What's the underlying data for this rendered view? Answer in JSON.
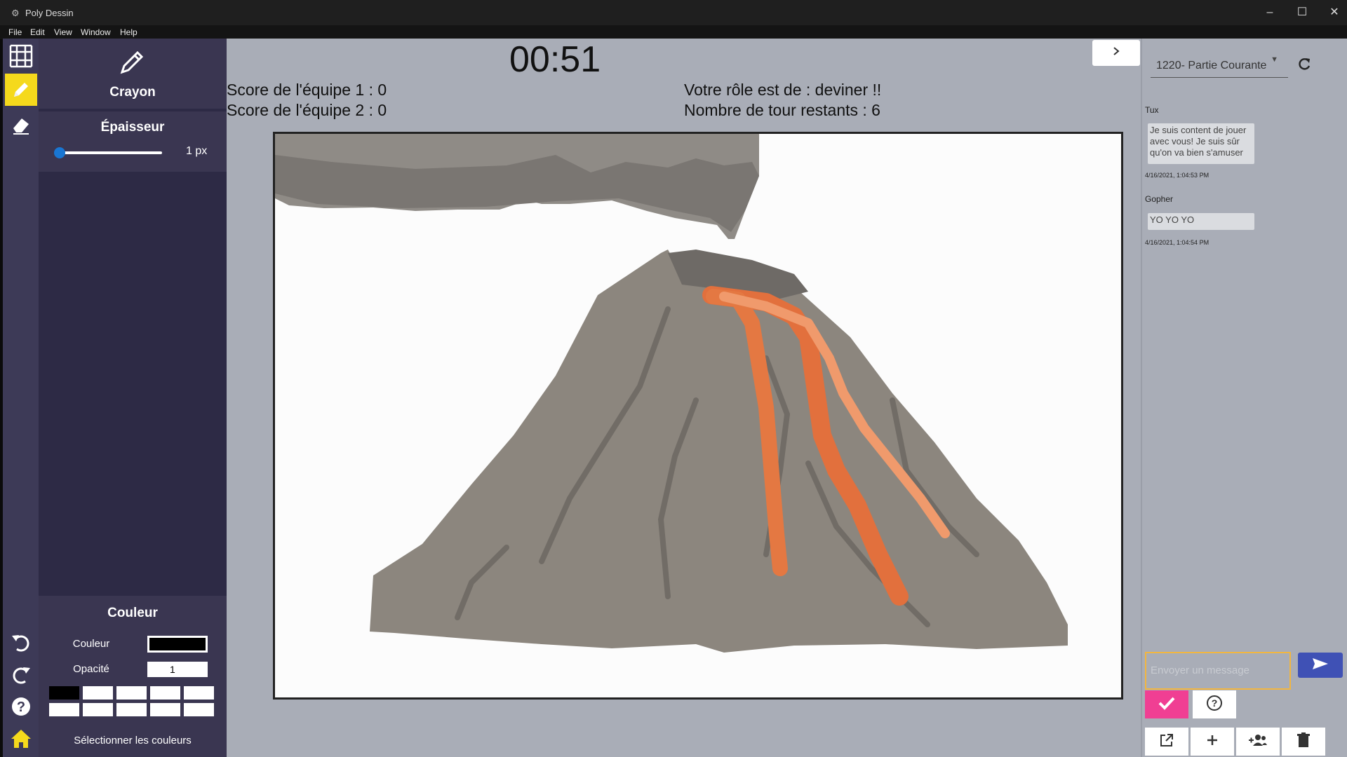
{
  "window": {
    "title": "Poly Dessin"
  },
  "menu": {
    "items": [
      "File",
      "Edit",
      "View",
      "Window",
      "Help"
    ]
  },
  "tool": {
    "name": "Crayon"
  },
  "thickness": {
    "title": "Épaisseur",
    "value_label": "1 px",
    "value": 1
  },
  "color_panel": {
    "title": "Couleur",
    "color_label": "Couleur",
    "current_color": "#000000",
    "opacity_label": "Opacité",
    "opacity_value": "1",
    "palette": [
      "#000000",
      "#ffffff",
      "#ffffff",
      "#ffffff",
      "#ffffff",
      "#ffffff",
      "#ffffff",
      "#ffffff",
      "#ffffff",
      "#ffffff"
    ],
    "select_label": "Sélectionner les couleurs"
  },
  "game": {
    "timer": "00:51",
    "score_team1": "Score de l'équipe 1 : 0",
    "score_team2": "Score de l'équipe 2 : 0",
    "role": "Votre rôle est de : deviner !!",
    "rounds_left": "Nombre de tour restants : 6"
  },
  "chat": {
    "room": "1220- Partie Courante",
    "messages": [
      {
        "author": "Tux",
        "text": "Je suis content de jouer avec vous! Je suis sûr qu'on va bien s'amuser",
        "time": "4/16/2021, 1:04:53 PM"
      },
      {
        "author": "Gopher",
        "text": "YO YO YO",
        "time": "4/16/2021, 1:04:54 PM"
      }
    ],
    "input_placeholder": "Envoyer un message"
  },
  "icons": {
    "rail": [
      "grid-icon",
      "pencil-icon",
      "eraser-icon",
      "undo-icon",
      "redo-icon",
      "help-icon",
      "home-icon"
    ],
    "chat_bottom": [
      "open-external-icon",
      "add-icon",
      "add-group-icon",
      "delete-icon"
    ]
  },
  "colors": {
    "accent_yellow": "#f5d91c",
    "panel_purple": "#3a3651",
    "send_blue": "#3f51b5",
    "check_pink": "#f03f93"
  }
}
